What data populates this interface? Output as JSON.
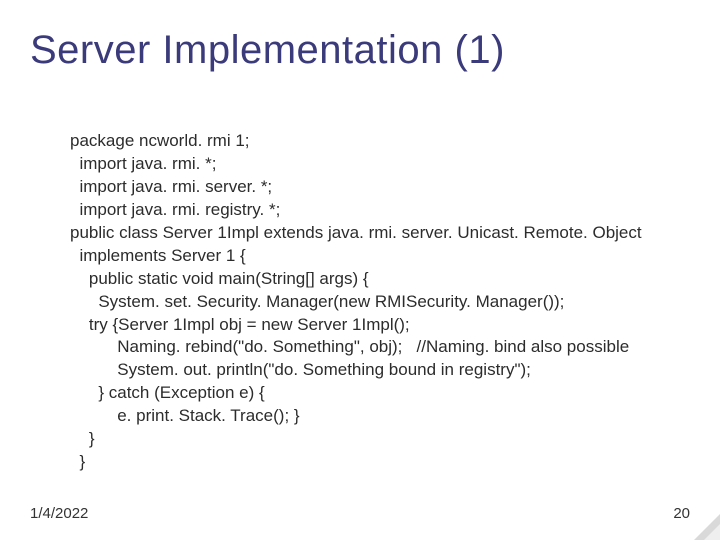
{
  "title": "Server Implementation (1)",
  "code": {
    "l0": "package ncworld. rmi 1;",
    "l1": "  import java. rmi. *;",
    "l2": "  import java. rmi. server. *;",
    "l3": "  import java. rmi. registry. *;",
    "l4": "public class Server 1Impl extends java. rmi. server. Unicast. Remote. Object",
    "l5": "  implements Server 1 {",
    "l6": "    public static void main(String[] args) {",
    "l7": "      System. set. Security. Manager(new RMISecurity. Manager());",
    "l8": "    try {Server 1Impl obj = new Server 1Impl();",
    "l9": "          Naming. rebind(\"do. Something\", obj);   //Naming. bind also possible",
    "l10": "          System. out. println(\"do. Something bound in registry\");",
    "l11": "      } catch (Exception e) {",
    "l12": "          e. print. Stack. Trace(); }",
    "l13": "    }",
    "l14": "  }"
  },
  "footer": {
    "date": "1/4/2022",
    "page": "20"
  }
}
